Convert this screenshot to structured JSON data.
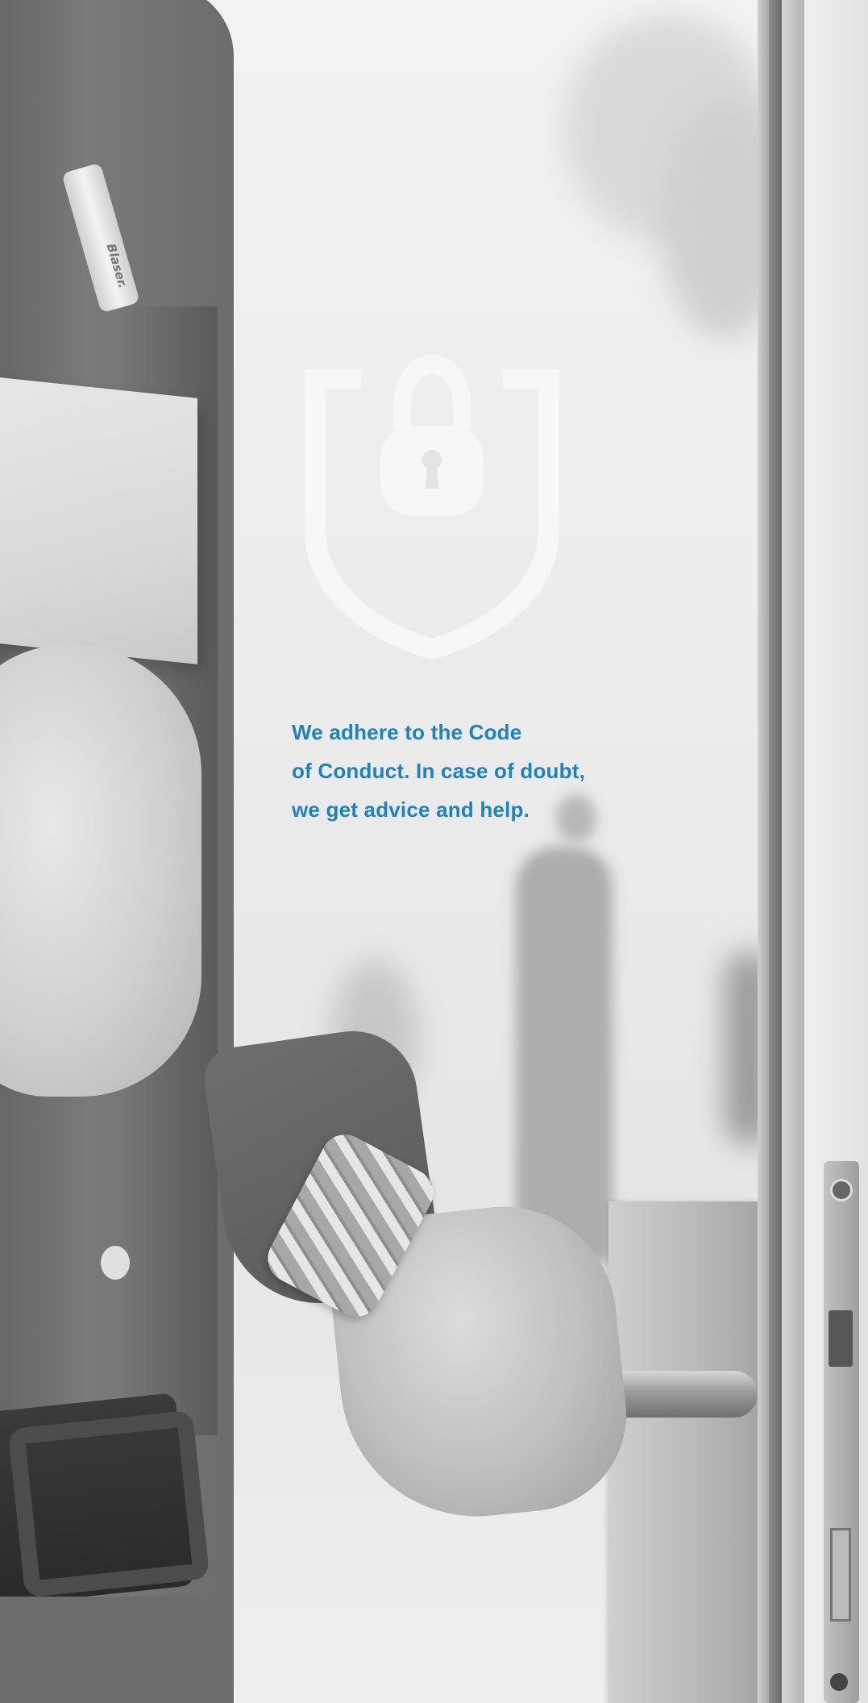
{
  "pen": {
    "brand_text": "Blaser."
  },
  "message": {
    "lines": [
      "We adhere to the Code",
      "of Conduct. In case of doubt,",
      "we get advice and help."
    ]
  },
  "icon": {
    "name": "shield-lock-icon"
  },
  "colors": {
    "accent": "#1e82c0",
    "icon_fill": "#f7f7f7"
  }
}
